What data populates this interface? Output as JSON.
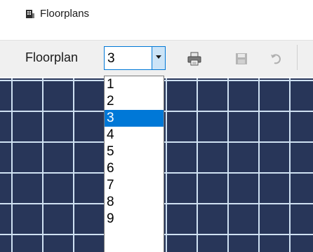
{
  "window": {
    "title": "Floorplans",
    "icon": "building-icon"
  },
  "toolbar": {
    "floorplan_label": "Floorplan",
    "selected_floor": "3",
    "buttons": [
      {
        "name": "print-button",
        "icon": "printer-icon"
      },
      {
        "name": "save-button",
        "icon": "save-icon"
      },
      {
        "name": "undo-button",
        "icon": "undo-icon"
      }
    ]
  },
  "dropdown": {
    "options": [
      "1",
      "2",
      "3",
      "4",
      "5",
      "6",
      "7",
      "8",
      "9"
    ],
    "selected_index": 2
  },
  "colors": {
    "canvas": "#283659",
    "grid_lines": "#cfe1f2",
    "selection": "#0078d7"
  }
}
